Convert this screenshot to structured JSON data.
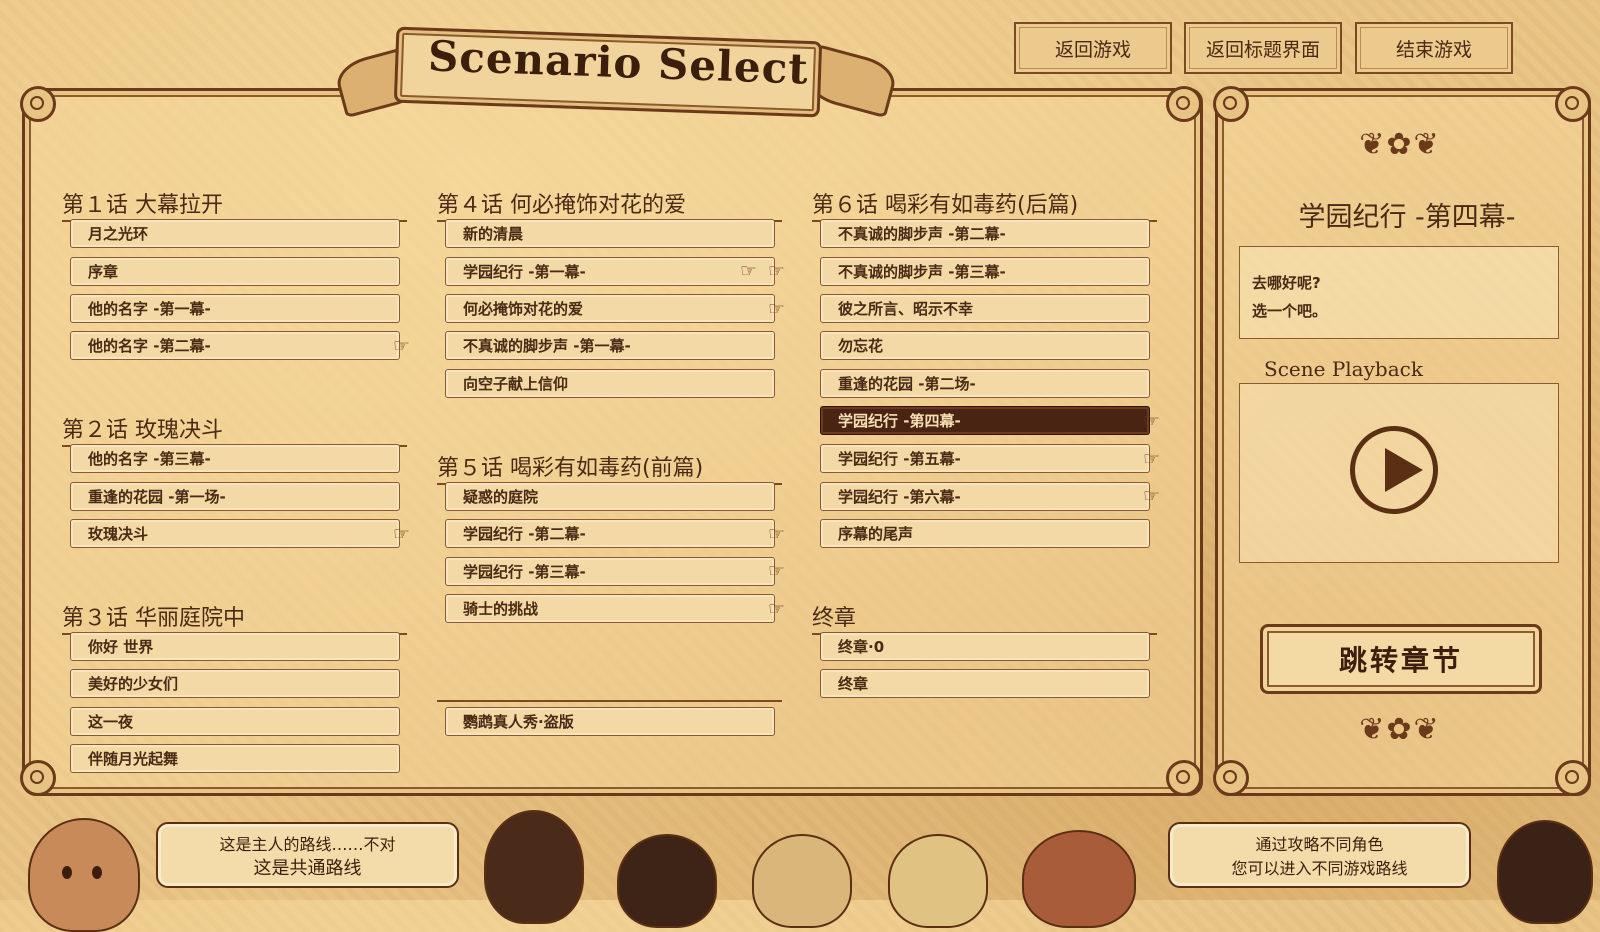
{
  "top_buttons": {
    "return_game": "返回游戏",
    "return_title": "返回标题界面",
    "end_game": "结束游戏"
  },
  "banner": {
    "title": "Scenario Select"
  },
  "chapters": {
    "ch1": {
      "title": "第１话  大幕拉开",
      "items": [
        "月之光环",
        "序章",
        "他的名字 -第一幕-",
        "他的名字 -第二幕-"
      ]
    },
    "ch2": {
      "title": "第２话  玫瑰决斗",
      "items": [
        "他的名字 -第三幕-",
        "重逢的花园 -第一场-",
        "玫瑰决斗"
      ]
    },
    "ch3": {
      "title": "第３话  华丽庭院中",
      "items": [
        "你好 世界",
        "美好的少女们",
        "这一夜",
        "伴随月光起舞"
      ]
    },
    "ch4": {
      "title": "第４话  何必掩饰对花的爱",
      "items": [
        "新的清晨",
        "学园纪行 -第一幕-",
        "何必掩饰对花的爱",
        "不真诚的脚步声 -第一幕-",
        "向空子献上信仰"
      ]
    },
    "ch5": {
      "title": "第５话  喝彩有如毒药(前篇)",
      "items": [
        "疑惑的庭院",
        "学园纪行 -第二幕-",
        "学园纪行 -第三幕-",
        "骑士的挑战"
      ]
    },
    "extra": {
      "items": [
        "鹦鹉真人秀·盗版"
      ]
    },
    "ch6": {
      "title": "第６话  喝彩有如毒药(后篇)",
      "items": [
        "不真诚的脚步声 -第二幕-",
        "不真诚的脚步声 -第三幕-",
        "彼之所言、昭示不幸",
        "勿忘花",
        "重逢的花园 -第二场-",
        "学园纪行 -第四幕-",
        "学园纪行 -第五幕-",
        "学园纪行 -第六幕-",
        "序幕的尾声"
      ]
    },
    "final": {
      "title": "终章",
      "items": [
        "终章·0",
        "终章"
      ]
    }
  },
  "selected_item": "学园纪行 -第四幕-",
  "detail": {
    "scene_title": "学园纪行 -第四幕-",
    "desc_line1": "去哪好呢?",
    "desc_line2": "选一个吧。",
    "playback_label": "Scene Playback",
    "jump_button": "跳转章节"
  },
  "bubbles": {
    "left_line1": "这是主人的路线……不对",
    "left_line2": "这是共通路线",
    "right_line1": "通过攻略不同角色",
    "right_line2": "您可以进入不同游戏路线"
  },
  "icons": {
    "branch": "pointing-hand-icon",
    "play": "play-icon"
  },
  "colors": {
    "parchment": "#e9c586",
    "frame": "#6b3a1a",
    "selected": "#4a2412"
  }
}
